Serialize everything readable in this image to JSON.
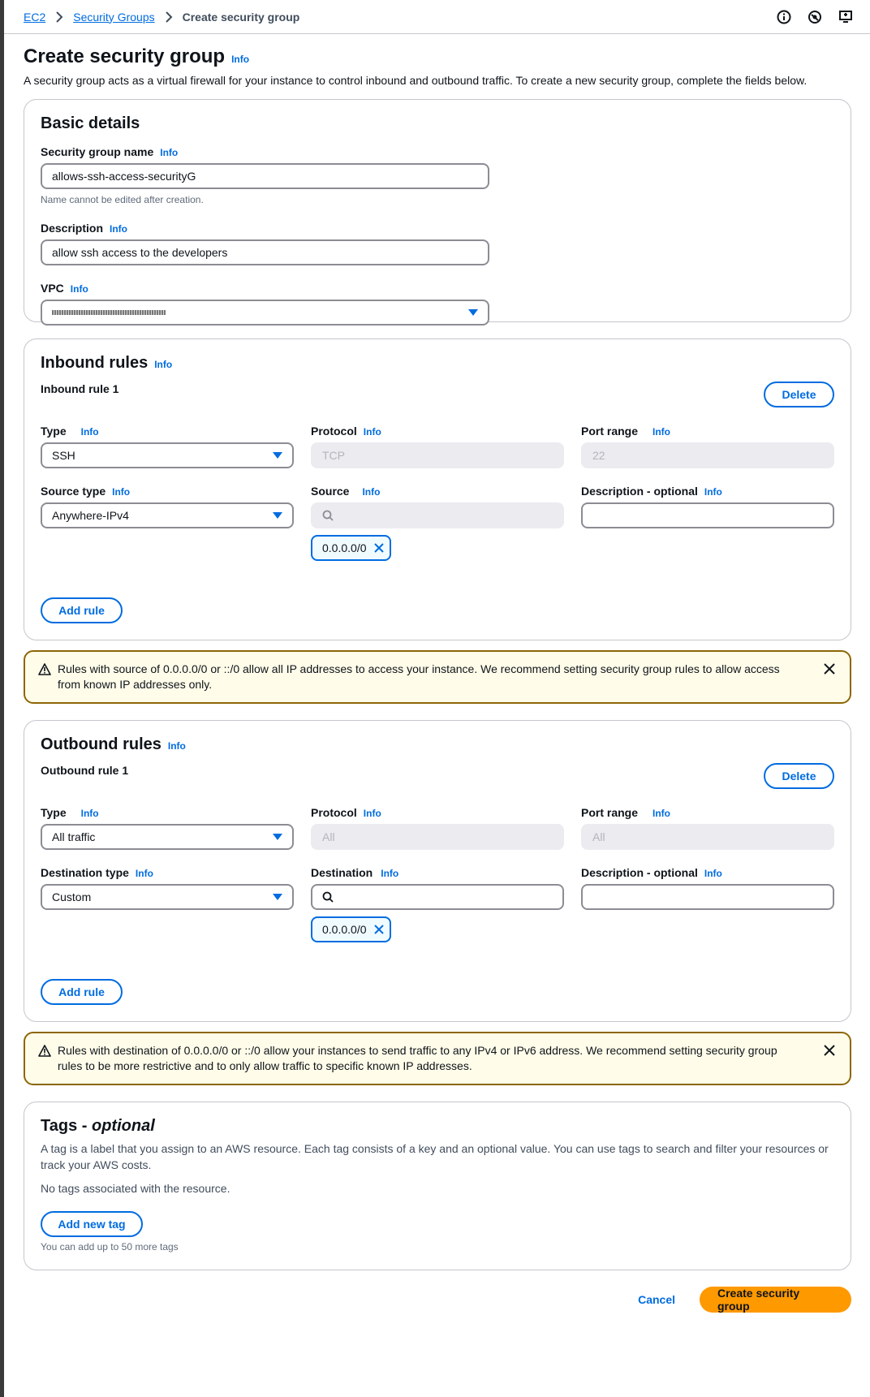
{
  "breadcrumb": {
    "items": [
      "EC2",
      "Security Groups"
    ],
    "current": "Create security group"
  },
  "icons": {
    "info": "info-circle-icon",
    "notifications": "notifications-icon",
    "tools": "screen-tools-icon"
  },
  "header": {
    "title": "Create security group",
    "info": "Info",
    "description": "A security group acts as a virtual firewall for your instance to control inbound and outbound traffic. To create a new security group, complete the fields below."
  },
  "basic": {
    "title": "Basic details",
    "name_label": "Security group name",
    "name_info": "Info",
    "name_value": "allows-ssh-access-securityG",
    "name_hint": "Name cannot be edited after creation.",
    "desc_label": "Description",
    "desc_info": "Info",
    "desc_value": "allow ssh access to the developers",
    "vpc_label": "VPC",
    "vpc_info": "Info"
  },
  "inbound": {
    "title": "Inbound rules",
    "info": "Info",
    "rule_title": "Inbound rule 1",
    "delete": "Delete",
    "type_label": "Type",
    "type_value": "SSH",
    "protocol_label": "Protocol",
    "protocol_value": "TCP",
    "port_label": "Port range",
    "port_value": "22",
    "source_type_label": "Source type",
    "source_type_value": "Anywhere-IPv4",
    "source_label": "Source",
    "desc_label": "Description - optional",
    "token": "0.0.0.0/0",
    "add_rule": "Add rule",
    "info_link": "Info"
  },
  "inbound_warning": "Rules with source of 0.0.0.0/0 or ::/0 allow all IP addresses to access your instance. We recommend setting security group rules to allow access from known IP addresses only.",
  "outbound": {
    "title": "Outbound rules",
    "info": "Info",
    "rule_title": "Outbound rule 1",
    "delete": "Delete",
    "type_label": "Type",
    "type_value": "All traffic",
    "protocol_label": "Protocol",
    "protocol_value": "All",
    "port_label": "Port range",
    "port_value": "All",
    "dest_type_label": "Destination type",
    "dest_type_value": "Custom",
    "dest_label": "Destination",
    "desc_label": "Description - optional",
    "token": "0.0.0.0/0",
    "add_rule": "Add rule",
    "info_link": "Info"
  },
  "outbound_warning": "Rules with destination of 0.0.0.0/0 or ::/0 allow your instances to send traffic to any IPv4 or IPv6 address. We recommend setting security group rules to be more restrictive and to only allow traffic to specific known IP addresses.",
  "tags": {
    "title": "Tags",
    "optional": "optional",
    "description": "A tag is a label that you assign to an AWS resource. Each tag consists of a key and an optional value. You can use tags to search and filter your resources or track your AWS costs.",
    "empty": "No tags associated with the resource.",
    "add": "Add new tag",
    "hint": "You can add up to 50 more tags"
  },
  "footer": {
    "cancel": "Cancel",
    "create": "Create security group"
  },
  "colors": {
    "link": "#006ce0",
    "primary": "#ff9900",
    "warning_border": "#8d6605",
    "warning_bg": "#fffce9"
  }
}
